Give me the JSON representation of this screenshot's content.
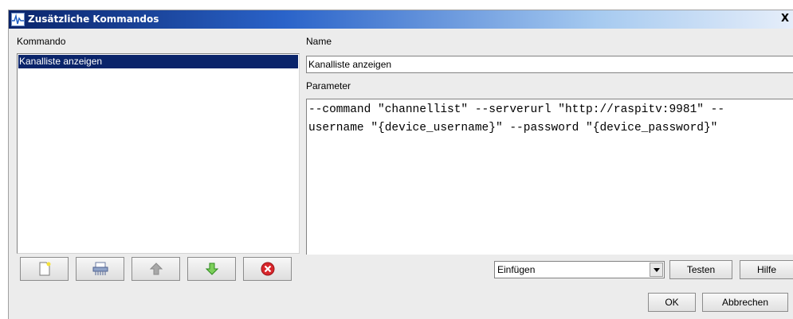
{
  "window": {
    "title": "Zusätzliche Kommandos",
    "close_label": "X"
  },
  "left": {
    "header": "Kommando",
    "items": [
      {
        "label": "Kanalliste anzeigen",
        "selected": true
      }
    ]
  },
  "right": {
    "name_label": "Name",
    "name_value": "Kanalliste anzeigen",
    "parameter_label": "Parameter",
    "parameter_lines": [
      "--command \"channellist\" --serverurl \"http://raspitv:9981\" --",
      "username \"{device_username}\" --password \"{device_password}\""
    ]
  },
  "toolbar": {
    "icons": [
      "new-icon",
      "shredder-icon",
      "arrow-up-icon",
      "arrow-down-icon",
      "delete-icon"
    ]
  },
  "insert_combo": {
    "selected": "Einfügen"
  },
  "buttons": {
    "test": "Testen",
    "help": "Hilfe",
    "ok": "OK",
    "cancel": "Abbrechen"
  },
  "colors": {
    "selection": "#0a246a",
    "arrow_down_green": "#3fae2a",
    "delete_red": "#d8262b"
  }
}
